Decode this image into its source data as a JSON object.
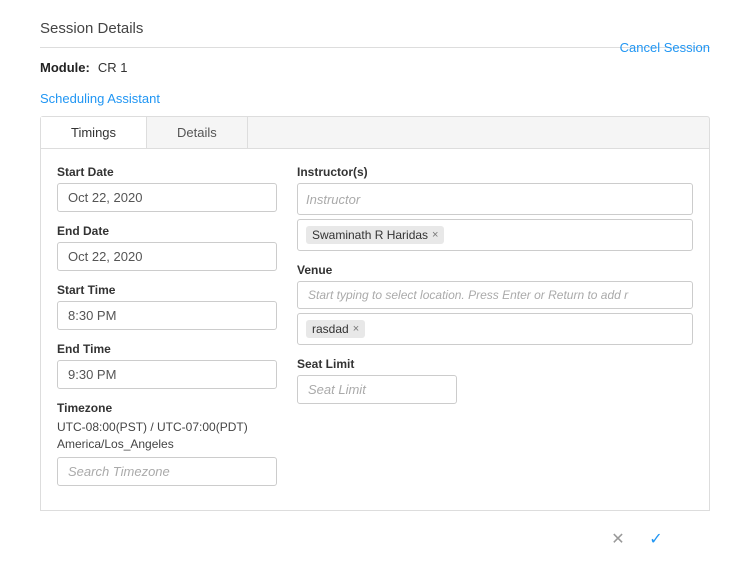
{
  "page": {
    "title": "Session Details",
    "module_label": "Module:",
    "module_value": "CR 1",
    "cancel_session_label": "Cancel Session",
    "scheduling_assistant_label": "Scheduling Assistant"
  },
  "tabs": [
    {
      "label": "Timings",
      "active": true
    },
    {
      "label": "Details",
      "active": false
    }
  ],
  "form": {
    "left": {
      "start_date_label": "Start Date",
      "start_date_value": "Oct 22, 2020",
      "end_date_label": "End Date",
      "end_date_value": "Oct 22, 2020",
      "start_time_label": "Start Time",
      "start_time_value": "8:30 PM",
      "end_time_label": "End Time",
      "end_time_value": "9:30 PM",
      "timezone_label": "Timezone",
      "timezone_text": "UTC-08:00(PST) / UTC-07:00(PDT) America/Los_Angeles",
      "timezone_placeholder": "Search Timezone"
    },
    "right": {
      "instructors_label": "Instructor(s)",
      "instructor_placeholder": "Instructor",
      "instructor_tag": "Swaminath R Haridas",
      "venue_label": "Venue",
      "venue_placeholder": "Start typing to select location. Press Enter or Return to add r",
      "venue_tag": "rasdad",
      "seat_limit_label": "Seat Limit",
      "seat_limit_placeholder": "Seat Limit"
    }
  },
  "footer": {
    "cancel_icon": "✕",
    "confirm_icon": "✓"
  }
}
